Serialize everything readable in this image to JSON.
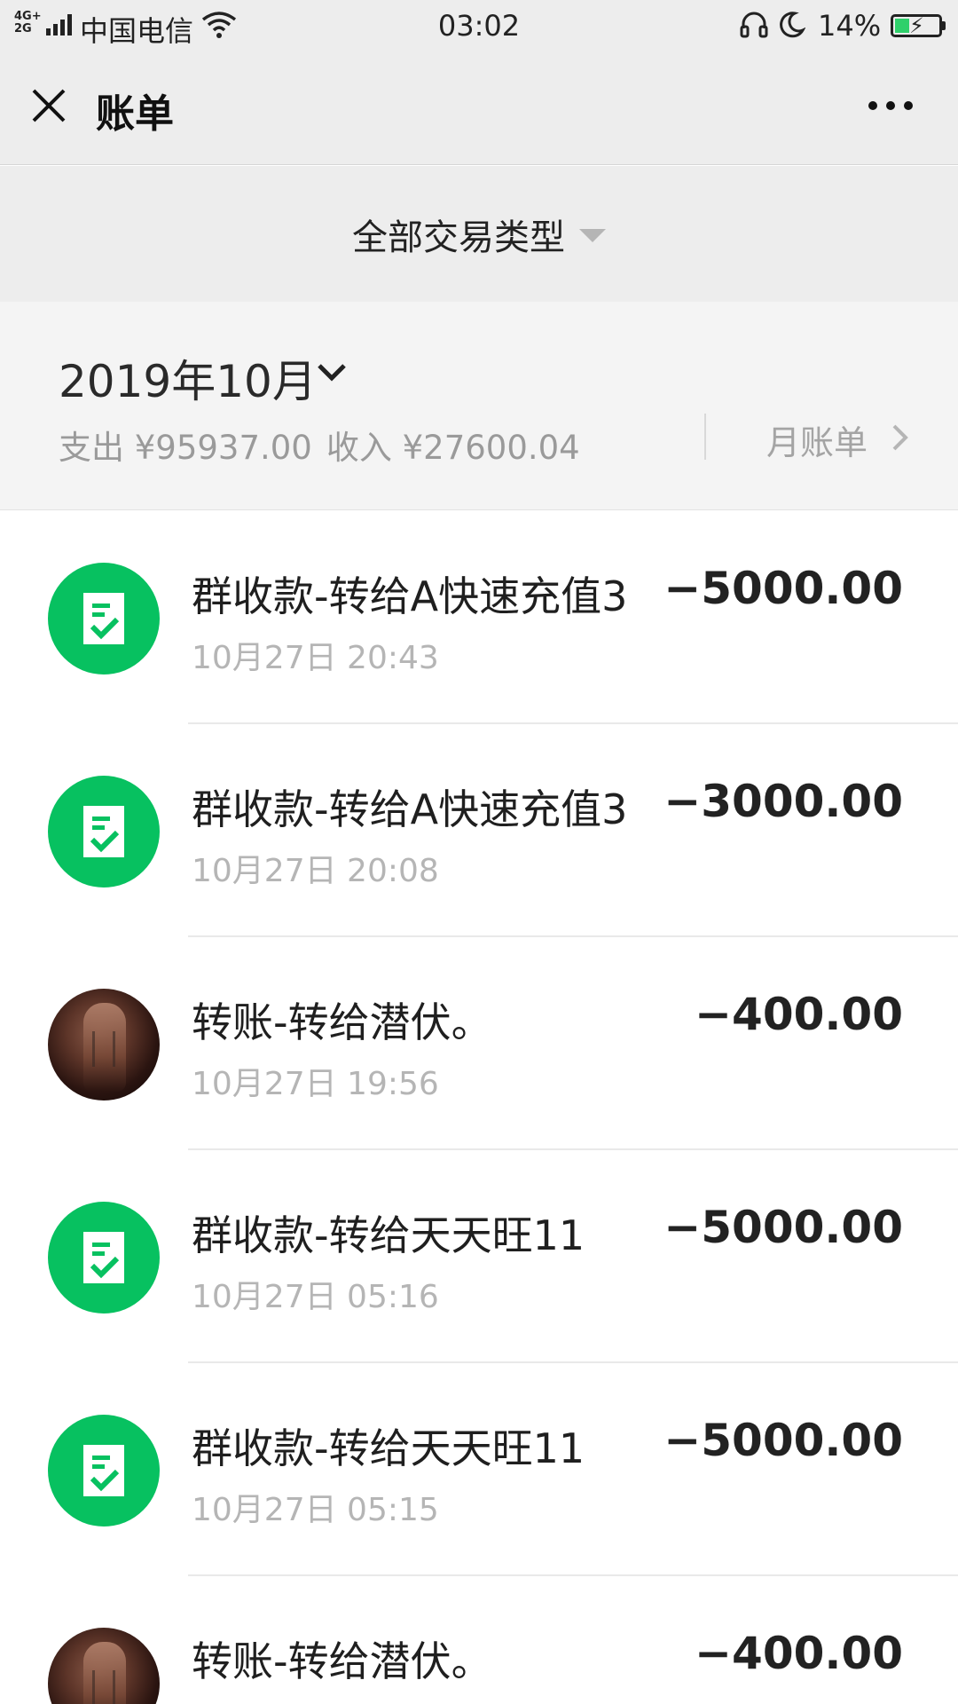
{
  "status_bar": {
    "network": "4G+ 2G",
    "carrier": "中国电信",
    "time": "03:02",
    "battery_percent": "14%"
  },
  "nav": {
    "title": "账单"
  },
  "filter": {
    "label": "全部交易类型"
  },
  "month_header": {
    "month": "2019年10月",
    "expense": "支出 ¥95937.00",
    "income": "收入 ¥27600.04",
    "monthly_bill": "月账单"
  },
  "transactions": [
    {
      "title": "群收款-转给A快速充值3",
      "time": "10月27日 20:43",
      "amount": "−5000.00",
      "icon": "group-payment-icon"
    },
    {
      "title": "群收款-转给A快速充值3",
      "time": "10月27日 20:08",
      "amount": "−3000.00",
      "icon": "group-payment-icon"
    },
    {
      "title": "转账-转给潜伏。",
      "time": "10月27日 19:56",
      "amount": "−400.00",
      "icon": "user-avatar"
    },
    {
      "title": "群收款-转给天天旺11",
      "time": "10月27日 05:16",
      "amount": "−5000.00",
      "icon": "group-payment-icon"
    },
    {
      "title": "群收款-转给天天旺11",
      "time": "10月27日 05:15",
      "amount": "−5000.00",
      "icon": "group-payment-icon"
    },
    {
      "title": "转账-转给潜伏。",
      "time": "",
      "amount": "−400.00",
      "icon": "user-avatar"
    }
  ],
  "colors": {
    "accent": "#07c160",
    "background": "#ededed"
  }
}
